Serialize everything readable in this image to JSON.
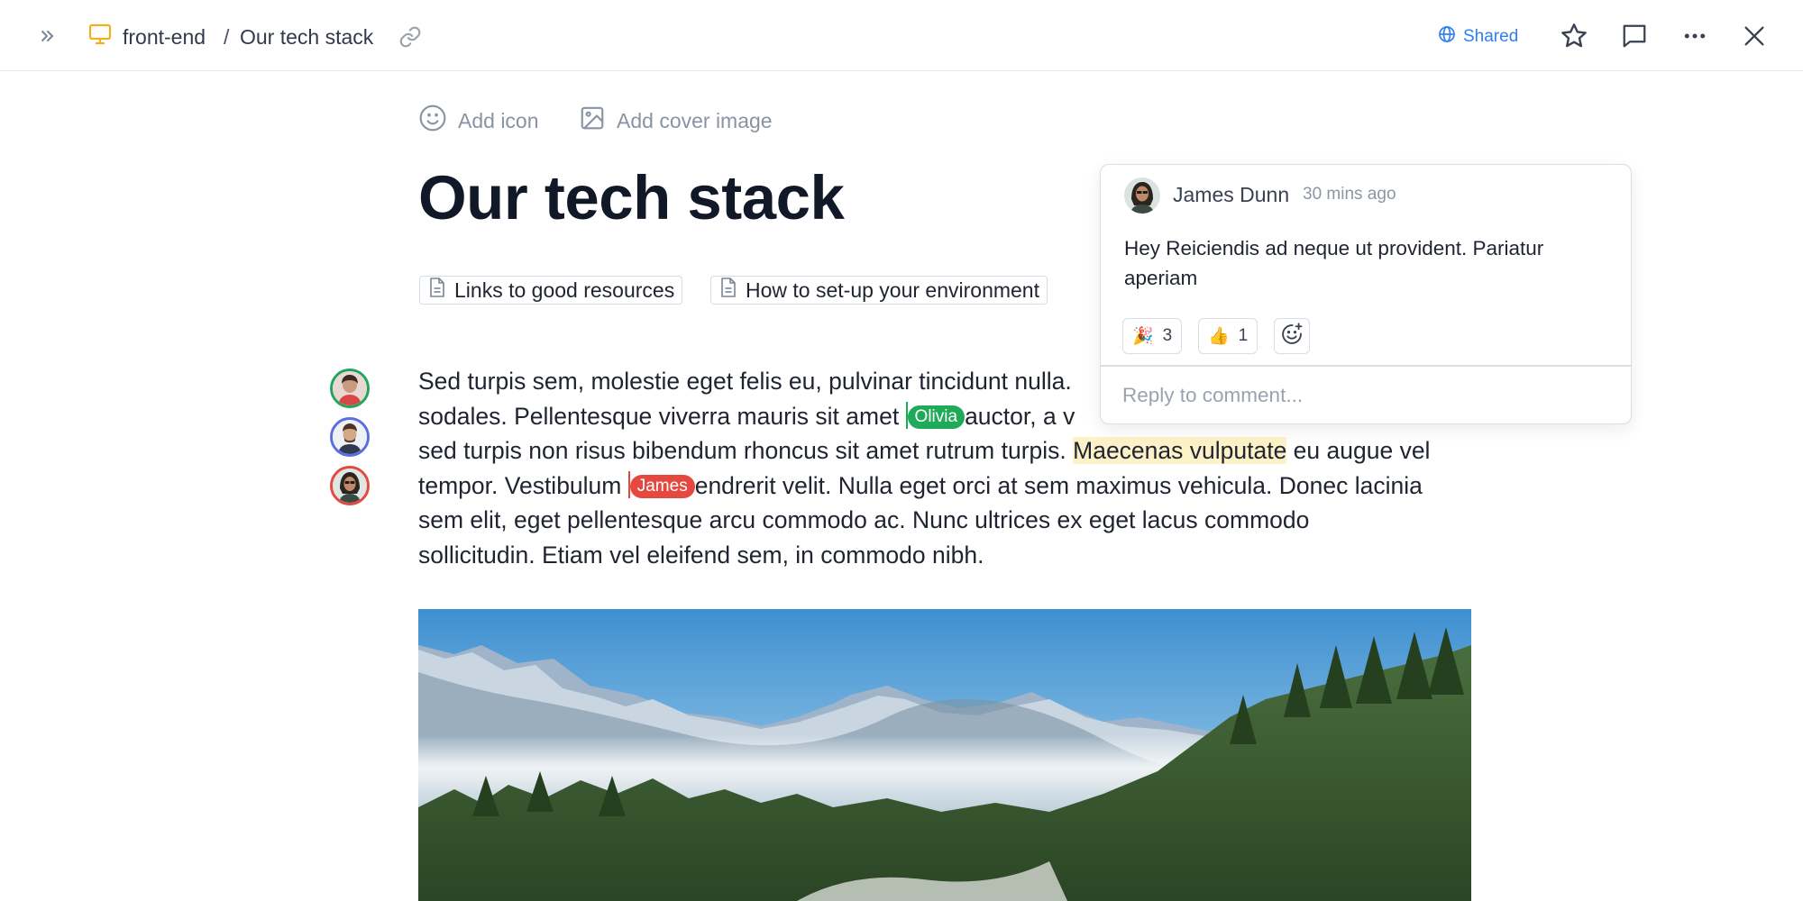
{
  "topbar": {
    "expand_icon": "chevrons-right-icon",
    "space_icon": "monitor-icon",
    "space_name": "front-end",
    "separator": "/",
    "page_name": "Our tech stack",
    "link_icon": "link-icon",
    "shared_label": "Shared",
    "shared_icon": "globe-icon",
    "actions": [
      "star-icon",
      "comment-icon",
      "more-icon",
      "close-icon"
    ]
  },
  "page": {
    "add_icon_label": "Add icon",
    "add_cover_label": "Add cover image",
    "title": "Our tech stack",
    "linked_docs": [
      {
        "label": "Links to good resources",
        "icon": "document-icon"
      },
      {
        "label": "How to set-up your environment",
        "icon": "document-icon"
      }
    ]
  },
  "presence": [
    {
      "ring_color": "#22a55b"
    },
    {
      "ring_color": "#5b6ee1"
    },
    {
      "ring_color": "#e5483f"
    }
  ],
  "body": {
    "line1": "Sed turpis sem, molestie eget felis eu, pulvinar tincidunt nulla.",
    "line2a": "sodales. Pellentesque viverra mauris sit amet ",
    "line2b": "auctor, a v",
    "line3a": "sed turpis non risus bibendum rhoncus sit amet rutrum turpis. ",
    "line3hl": "Maecenas vulputate",
    "line3b": " eu augue vel",
    "line4a": "tempor. Vestibulum ",
    "line4b": "endrerit velit. Nulla eget orci at sem maximus vehicula. Donec lacinia",
    "line5": "sem elit, eget pellentesque arcu commodo ac. Nunc ultrices ex eget lacus commodo",
    "line6": "sollicitudin. Etiam vel eleifend sem, in commodo nibh.",
    "cursors": [
      {
        "name": "Olivia",
        "color": "#1faa59"
      },
      {
        "name": "James",
        "color": "#e5483f"
      }
    ]
  },
  "comment": {
    "author": "James Dunn",
    "time": "30 mins ago",
    "text": "Hey Reiciendis ad neque ut provident. Pariatur aperiam",
    "reactions": [
      {
        "emoji": "🎉",
        "count": "3"
      },
      {
        "emoji": "👍",
        "count": "1"
      }
    ],
    "add_reaction_icon": "smiley-plus-icon",
    "reply_placeholder": "Reply to comment..."
  },
  "cover_image": "mountain-landscape"
}
